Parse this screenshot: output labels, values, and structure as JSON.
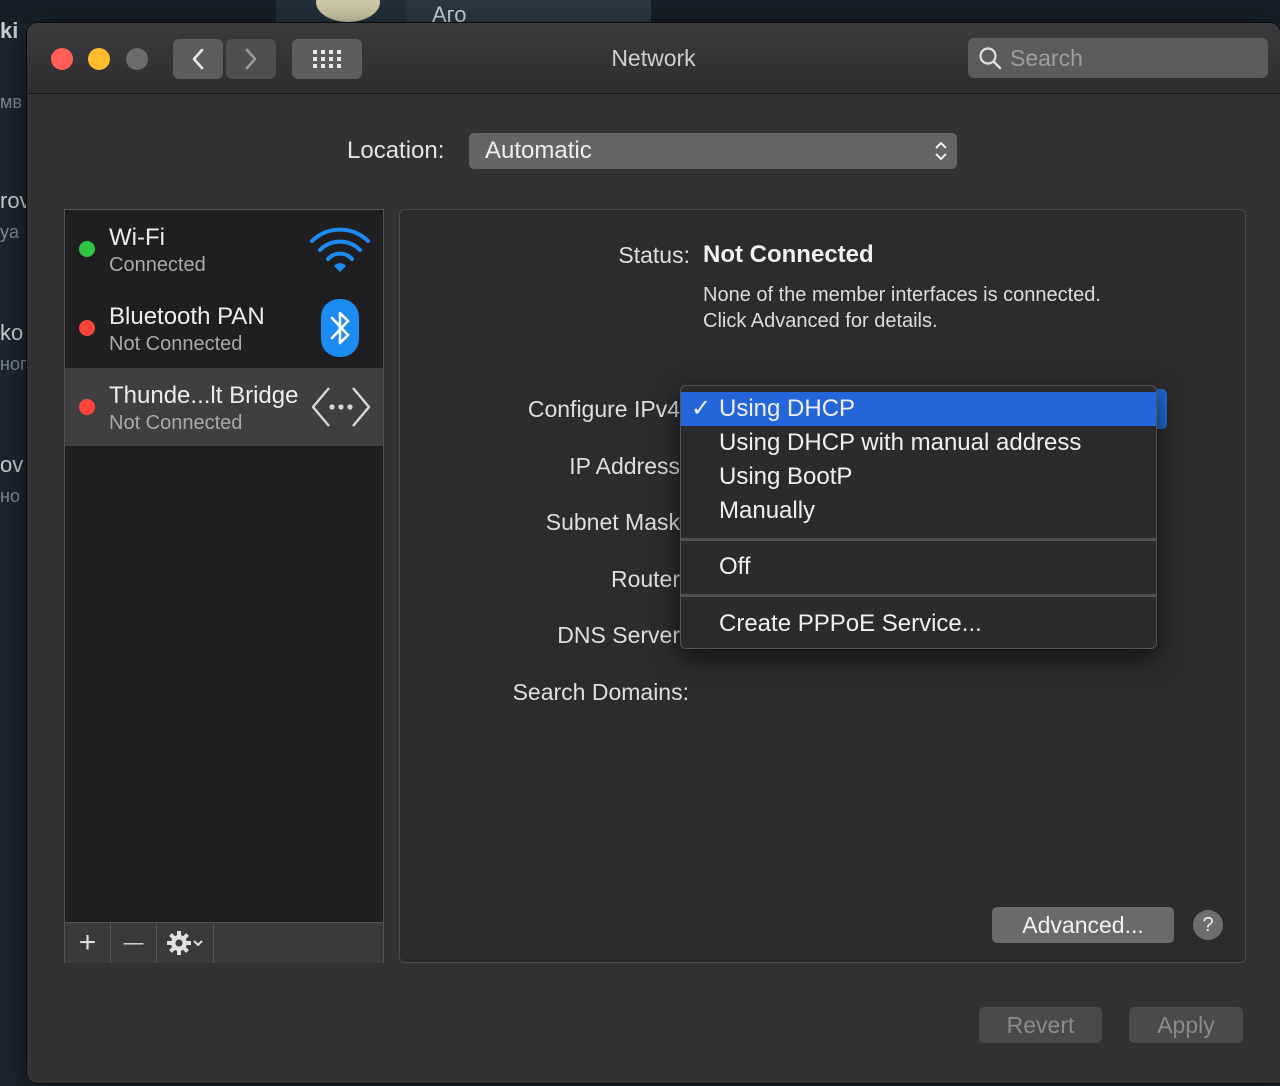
{
  "background": {
    "fragments": [
      "ki",
      "мв",
      "rov",
      "ya",
      "ko",
      "ног",
      "ov",
      "но"
    ],
    "tab_text": "Аго"
  },
  "window": {
    "title": "Network",
    "search_placeholder": "Search",
    "traffic_lights": [
      "#ff5f57",
      "#febc2e",
      "#6b6b6b"
    ]
  },
  "location": {
    "label": "Location:",
    "value": "Automatic"
  },
  "services": [
    {
      "name": "Wi-Fi",
      "status": "Connected",
      "status_color": "#2ec742",
      "icon": "wifi-icon"
    },
    {
      "name": "Bluetooth PAN",
      "status": "Not Connected",
      "status_color": "#ff453a",
      "icon": "bluetooth-icon"
    },
    {
      "name": "Thunde...lt Bridge",
      "status": "Not Connected",
      "status_color": "#ff453a",
      "icon": "thunderbolt-bridge-icon",
      "selected": true
    }
  ],
  "list_toolbar": {
    "add": "+",
    "remove": "—",
    "gear": "gear-icon"
  },
  "detail": {
    "status_label": "Status:",
    "status_value": "Not Connected",
    "status_desc_line1": "None of the member interfaces is connected.",
    "status_desc_line2": "Click Advanced for details.",
    "configure_label": "Configure IPv4",
    "ip_label": "IP Address",
    "subnet_label": "Subnet Mask",
    "router_label": "Router",
    "dns_label": "DNS Server",
    "search_domains_label": "Search Domains:",
    "advanced_button": "Advanced...",
    "help_button": "?"
  },
  "footer": {
    "revert": "Revert",
    "apply": "Apply"
  },
  "dropdown": {
    "selected_index": 0,
    "check": "✓",
    "items": [
      "Using DHCP",
      "Using DHCP with manual address",
      "Using BootP",
      "Manually",
      "Off",
      "Create PPPoE Service..."
    ]
  }
}
